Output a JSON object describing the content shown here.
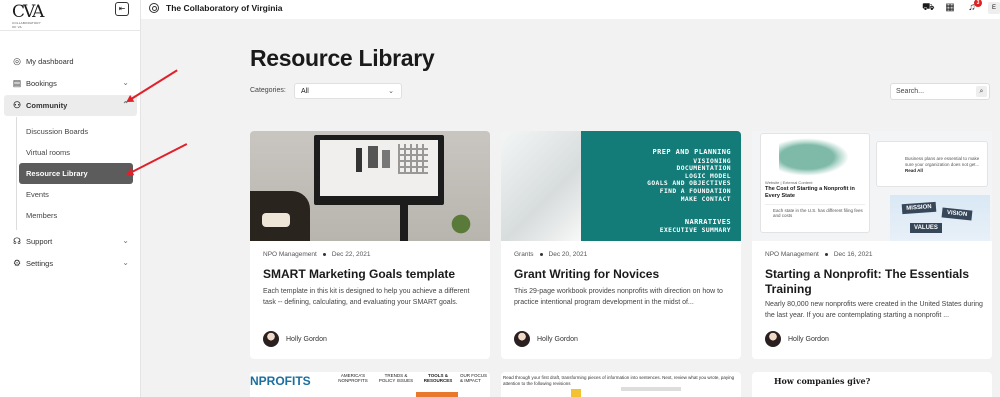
{
  "app": {
    "logo_text": "CVA",
    "logo_subtext": "COLLABORATORY OF VA",
    "org_name": "The Collaboratory of Virginia"
  },
  "topbar": {
    "notification_count": "3",
    "user_initial": "E"
  },
  "sidebar": {
    "items": [
      {
        "label": "My dashboard",
        "icon": "compass-icon"
      },
      {
        "label": "Bookings",
        "icon": "calendar-icon"
      },
      {
        "label": "Community",
        "icon": "people-icon"
      },
      {
        "label": "Support",
        "icon": "headset-icon"
      },
      {
        "label": "Settings",
        "icon": "gear-icon"
      }
    ],
    "community_sub": [
      {
        "label": "Discussion Boards"
      },
      {
        "label": "Virtual rooms"
      },
      {
        "label": "Resource Library"
      },
      {
        "label": "Events"
      },
      {
        "label": "Members"
      }
    ]
  },
  "main": {
    "title": "Resource Library",
    "categories_label": "Categories:",
    "categories_value": "All",
    "search_placeholder": "Search..."
  },
  "cards": [
    {
      "category": "NPO Management",
      "date": "Dec 22, 2021",
      "title": "SMART Marketing Goals template",
      "description": "Each template in this kit is designed to help you achieve a different task -- defining, calculating, and evaluating your SMART goals.",
      "author": "Holly Gordon"
    },
    {
      "category": "Grants",
      "date": "Dec 20, 2021",
      "title": "Grant Writing for Novices",
      "description": "This 29-page workbook provides nonprofits with direction on how to practice intentional program development in the midst of...",
      "author": "Holly Gordon",
      "image_text": [
        "PREP AND PLANNING",
        "VISIONING",
        "DOCUMENTATION",
        "LOGIC MODEL",
        "GOALS AND OBJECTIVES",
        "FIND A FOUNDATION",
        "MAKE CONTACT"
      ],
      "image_text2": [
        "NARRATIVES",
        "EXECUTIVE SUMMARY"
      ]
    },
    {
      "category": "NPO Management",
      "date": "Dec 16, 2021",
      "title": "Starting a Nonprofit: The Essentials Training",
      "description": "Nearly 80,000 new nonprofits were created in the United States during the last year. If you are contemplating starting a nonprofit ...",
      "author": "Holly Gordon",
      "image_text": {
        "tag": "Website | External Content",
        "head": "The Cost of Starting a Nonprofit in Every State",
        "note": "Each state in the U.S. has different filing fees and costs",
        "plan": "Business plans are essential to make sure your organization does not get...",
        "read": "Read All",
        "mission": "MISSION",
        "vision": "VISION",
        "values": "VALUES"
      }
    }
  ],
  "bottom_cards": [
    {
      "text": [
        "NPROFITS",
        "AMERICA'S NONPROFITS",
        "TRENDS & POLICY ISSUES",
        "TOOLS & RESOURCES",
        "OUR FOCUS & IMPACT"
      ]
    },
    {
      "text": "Read through your first draft, transforming pieces of information into sentences. Next, review what you wrote, paying attention to the following revisions"
    },
    {
      "text": "How companies give?"
    }
  ],
  "colors": {
    "accent_red": "#e0202a",
    "teal": "#137b78",
    "selected_bg": "#5c5c5c"
  }
}
